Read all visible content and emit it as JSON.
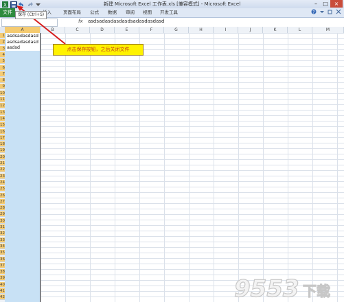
{
  "title_bar": {
    "title": "新建 Microsoft Excel 工作表.xls [兼容模式] - Microsoft Excel",
    "minimize": "–",
    "maximize": "□",
    "close": "×"
  },
  "tooltip": "保存 (Ctrl+S)",
  "ribbon": {
    "file_tab": "文件",
    "tabs": [
      "插入",
      "页面布局",
      "公式",
      "数据",
      "审阅",
      "视图",
      "开发工具"
    ],
    "right_icons": [
      "help-icon",
      "ribbon-minimize-icon",
      "restore-icon",
      "close-icon"
    ]
  },
  "formula_bar": {
    "fx": "fx",
    "value": "asdsadasdasdasdsadasdasdasd"
  },
  "columns": [
    "A",
    "B",
    "C",
    "D",
    "E",
    "F",
    "G",
    "H",
    "I",
    "J",
    "K",
    "L",
    "M"
  ],
  "rows": [
    "1",
    "2",
    "3",
    "4",
    "5",
    "6",
    "7",
    "8",
    "9",
    "10",
    "11",
    "12",
    "13",
    "14",
    "15",
    "16",
    "17",
    "18",
    "19",
    "20",
    "21",
    "22",
    "23",
    "24",
    "25",
    "26",
    "27",
    "28",
    "29",
    "30",
    "31",
    "32",
    "33",
    "34",
    "35",
    "36",
    "37",
    "38",
    "39",
    "40",
    "41",
    "42"
  ],
  "cell_a1": "asdsadasdasdasdsadasdasdasdsd",
  "callout": "点击保存按钮，之后关闭文件",
  "watermark": {
    "number": "9553",
    "text": "下载"
  }
}
